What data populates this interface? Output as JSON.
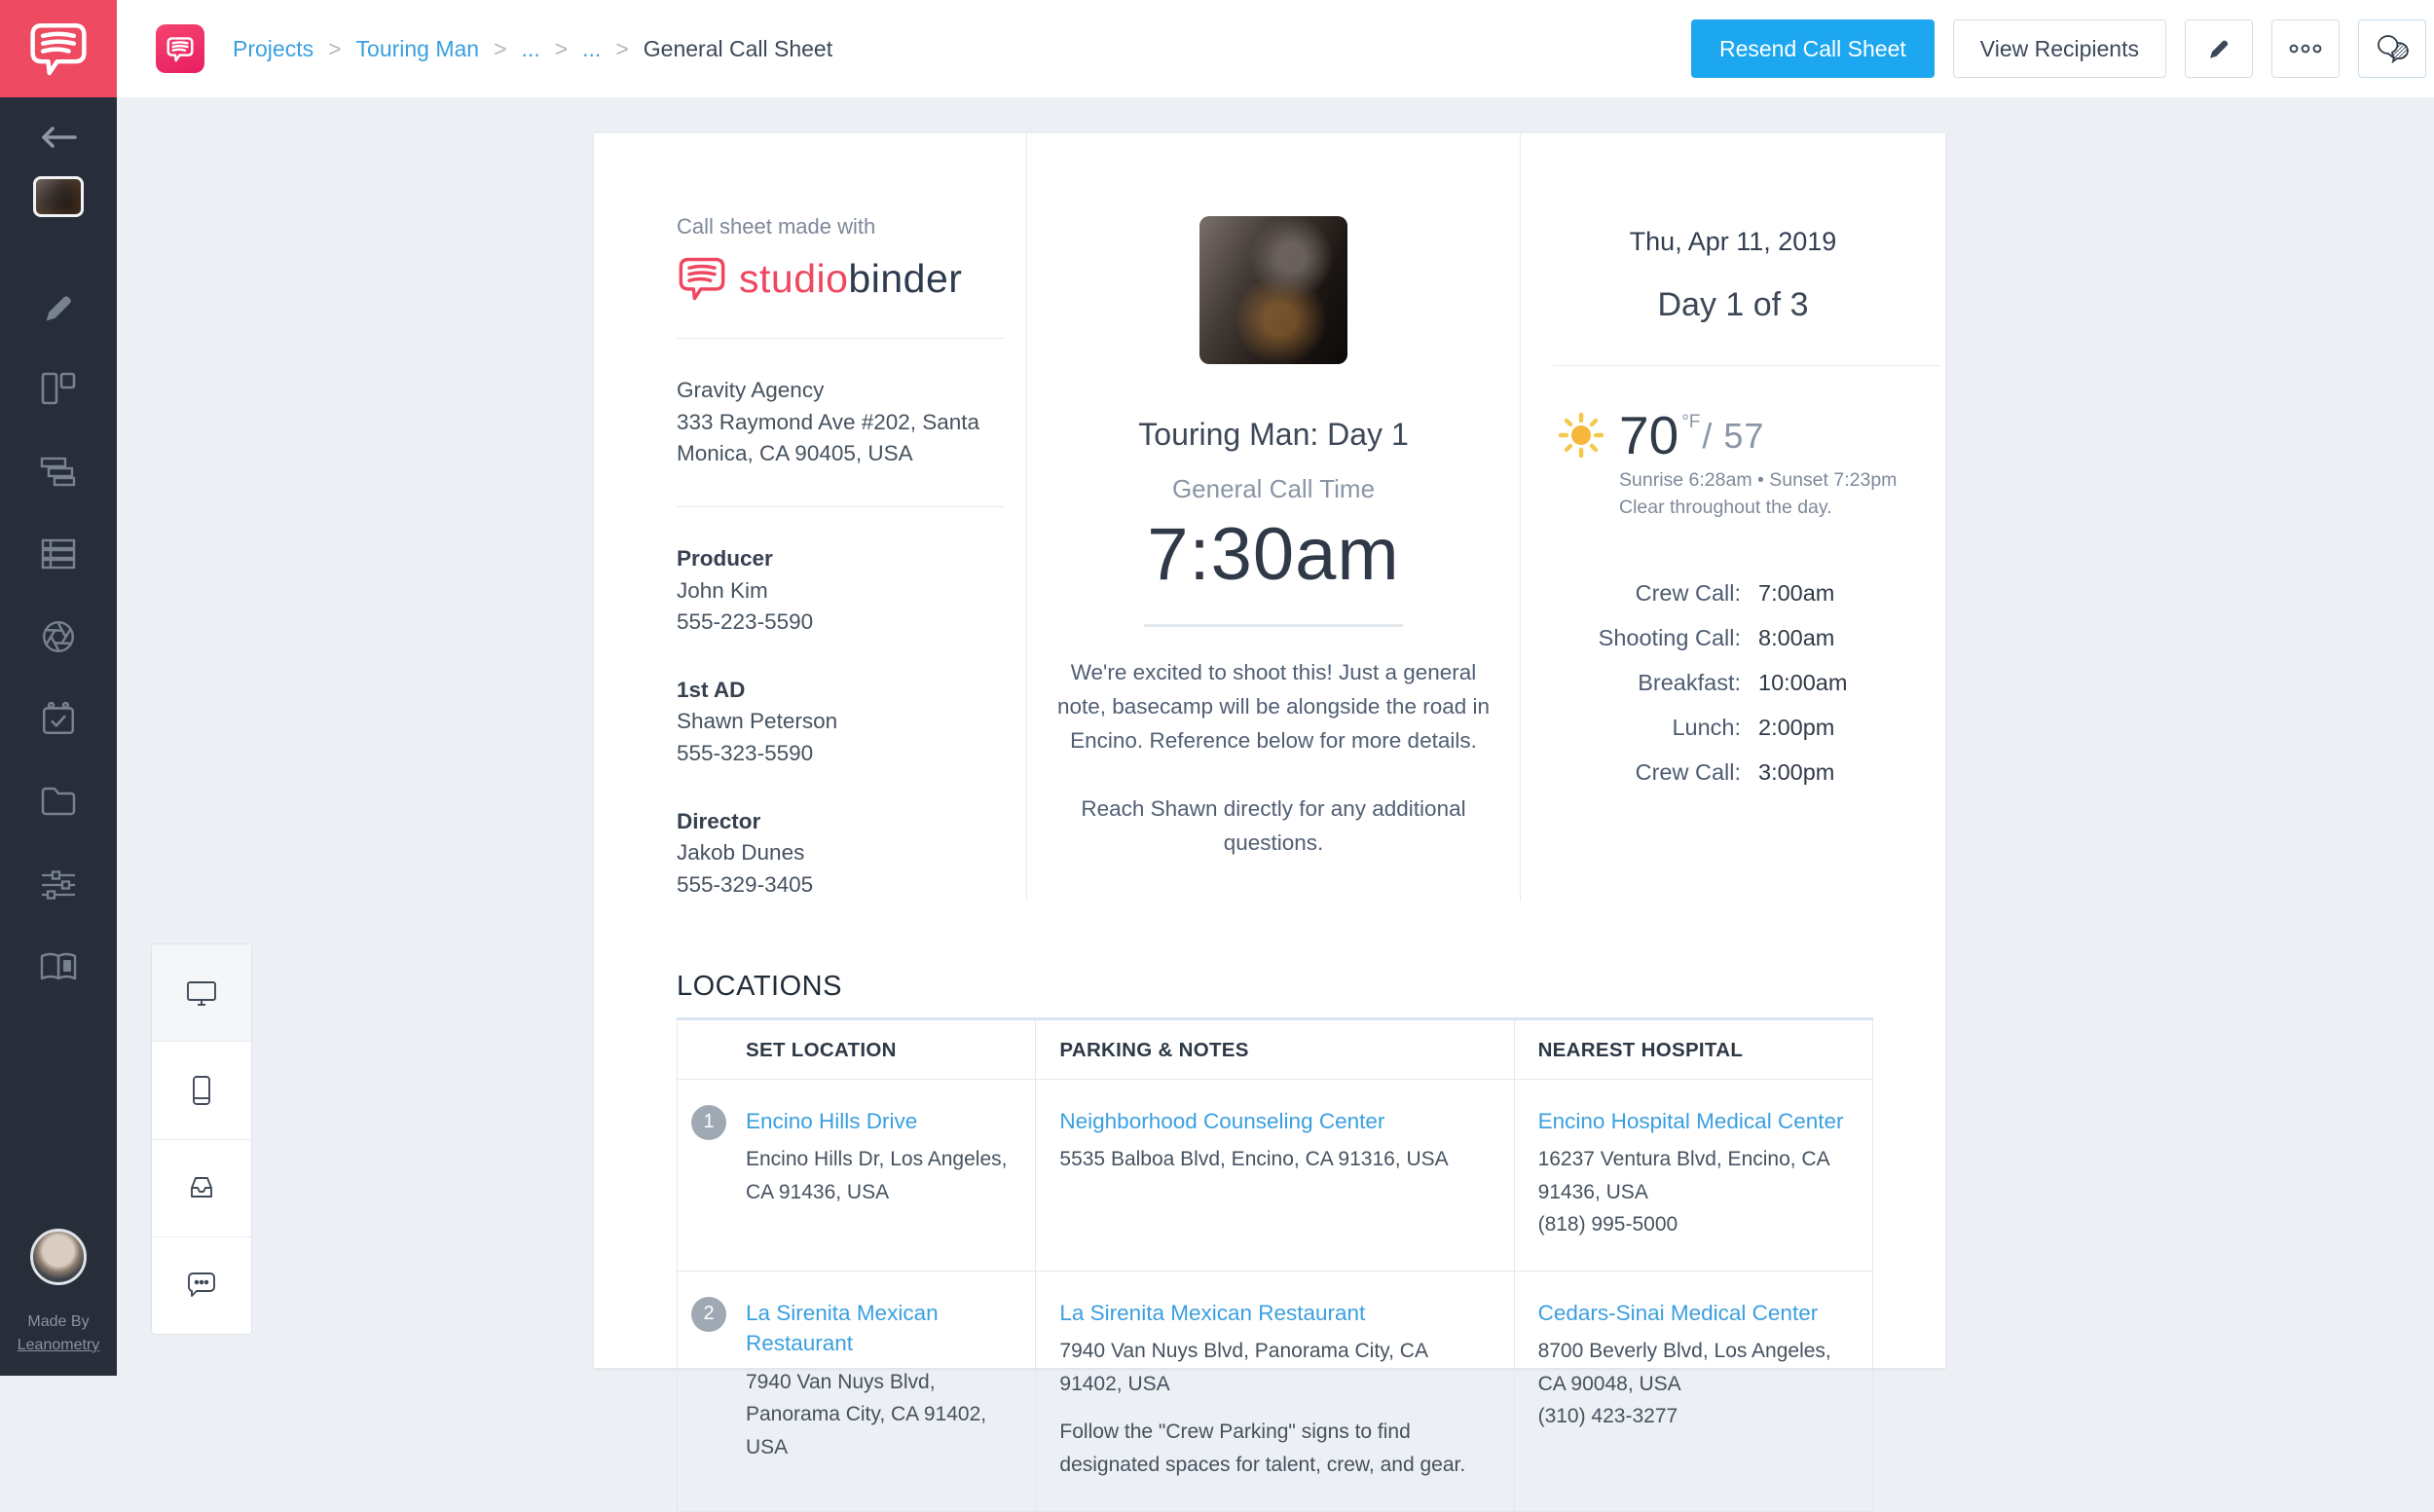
{
  "colors": {
    "accent_pink": "#ee4a62",
    "brand_pink_deep": "#ef2e68",
    "link_blue": "#3a9fe0",
    "button_blue": "#1ca7f0",
    "sidebar_bg": "#272d39",
    "page_bg": "#eceff3",
    "text_dark": "#2f3947",
    "text_gray": "#7e8999",
    "sun_yellow": "#f6bb40",
    "badge_gray": "#9fa9b3"
  },
  "header": {
    "breadcrumb": {
      "items": [
        "Projects",
        "Touring Man",
        "...",
        "..."
      ],
      "separator": ">",
      "current": "General Call Sheet"
    },
    "resend_label": "Resend Call Sheet",
    "view_recipients_label": "View Recipients",
    "icon_buttons": [
      "pencil-icon",
      "more-options-icon",
      "comments-icon"
    ]
  },
  "sidebar": {
    "icons": [
      "back-arrow-icon",
      "project-thumbnail",
      "pencil-icon",
      "board-icon",
      "stripboard-icon",
      "list-rows-icon",
      "shutter-icon",
      "calendar-check-icon",
      "folder-icon",
      "sliders-icon",
      "book-info-icon"
    ],
    "made_by_line1": "Made By",
    "made_by_line2": "Leanometry"
  },
  "device_panel": {
    "icons": [
      "desktop-icon",
      "mobile-icon",
      "inbox-icon",
      "chat-icon"
    ],
    "active": "desktop-icon"
  },
  "callsheet": {
    "made_with": "Call sheet made with",
    "logo_part1": "studio",
    "logo_part2": "binder",
    "company": "Gravity Agency",
    "company_address": "333 Raymond Ave #202, Santa Monica, CA 90405, USA",
    "contacts": [
      {
        "role": "Producer",
        "name": "John Kim",
        "phone": "555-223-5590"
      },
      {
        "role": "1st AD",
        "name": "Shawn Peterson",
        "phone": "555-323-5590"
      },
      {
        "role": "Director",
        "name": "Jakob Dunes",
        "phone": "555-329-3405"
      }
    ],
    "title": "Touring Man: Day 1",
    "call_time_label": "General Call Time",
    "call_time": "7:30am",
    "notes_1": "We're excited to shoot this! Just a general note, basecamp will be alongside the road in Encino. Reference below for more details.",
    "notes_2": "Reach Shawn directly for any additional questions.",
    "date": "Thu, Apr 11, 2019",
    "day_count": "Day 1 of 3",
    "weather": {
      "high": "70",
      "unit": "°F",
      "low": "/ 57",
      "sun_times": "Sunrise 6:28am • Sunset 7:23pm",
      "forecast": "Clear throughout the day."
    },
    "schedule": [
      {
        "label": "Crew Call:",
        "time": "7:00am"
      },
      {
        "label": "Shooting Call:",
        "time": "8:00am"
      },
      {
        "label": "Breakfast:",
        "time": "10:00am"
      },
      {
        "label": "Lunch:",
        "time": "2:00pm"
      },
      {
        "label": "Crew Call:",
        "time": "3:00pm"
      }
    ],
    "locations": {
      "heading": "LOCATIONS",
      "columns": [
        "SET LOCATION",
        "PARKING & NOTES",
        "NEAREST HOSPITAL"
      ],
      "rows": [
        {
          "num": "1",
          "set_name": "Encino Hills Drive",
          "set_address": "Encino Hills Dr, Los Angeles, CA 91436, USA",
          "parking_name": "Neighborhood Counseling Center",
          "parking_address": "5535 Balboa Blvd, Encino, CA 91316, USA",
          "hospital_name": "Encino Hospital Medical Center",
          "hospital_address": "16237 Ventura Blvd, Encino, CA 91436, USA",
          "hospital_phone": "(818) 995-5000"
        },
        {
          "num": "2",
          "set_name": "La Sirenita Mexican Restaurant",
          "set_address": "7940 Van Nuys Blvd, Panorama City, CA 91402, USA",
          "parking_name": "La Sirenita Mexican Restaurant",
          "parking_address": "7940 Van Nuys Blvd, Panorama City, CA 91402, USA",
          "parking_note": "Follow the \"Crew Parking\" signs to find designated spaces for talent, crew, and gear.",
          "hospital_name": "Cedars-Sinai Medical Center",
          "hospital_address": "8700 Beverly Blvd, Los Angeles, CA 90048, USA",
          "hospital_phone": "(310) 423-3277"
        }
      ]
    }
  }
}
